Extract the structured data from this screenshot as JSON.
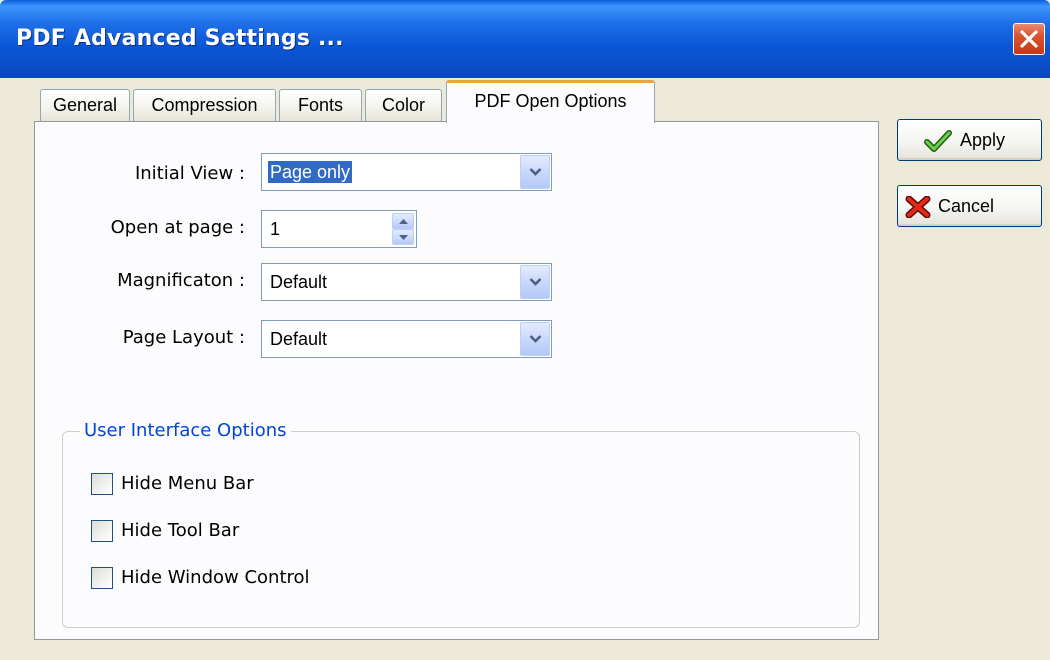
{
  "window": {
    "title": "PDF Advanced Settings ...",
    "titlebar_color": "#0a55d6"
  },
  "tabs": [
    {
      "label": "General",
      "active": false
    },
    {
      "label": "Compression",
      "active": false
    },
    {
      "label": "Fonts",
      "active": false
    },
    {
      "label": "Color",
      "active": false
    },
    {
      "label": "PDF Open Options",
      "active": true
    }
  ],
  "form": {
    "initial_view": {
      "label": "Initial View :",
      "value": "Page only"
    },
    "open_at_page": {
      "label": "Open at page :",
      "value": "1"
    },
    "magnification": {
      "label": "Magnificaton :",
      "value": "Default"
    },
    "page_layout": {
      "label": "Page Layout :",
      "value": "Default"
    }
  },
  "ui_options": {
    "title": "User Interface Options",
    "items": [
      {
        "label": "Hide Menu Bar",
        "checked": false
      },
      {
        "label": "Hide Tool Bar",
        "checked": false
      },
      {
        "label": "Hide Window Control",
        "checked": false
      }
    ]
  },
  "buttons": {
    "apply": {
      "label": "Apply",
      "icon": "checkmark-icon"
    },
    "cancel": {
      "label": "Cancel",
      "icon": "x-icon"
    }
  },
  "colors": {
    "group_title": "#0046d5",
    "selection": "#316ac5",
    "active_tab_accent": "#f0a43a"
  }
}
